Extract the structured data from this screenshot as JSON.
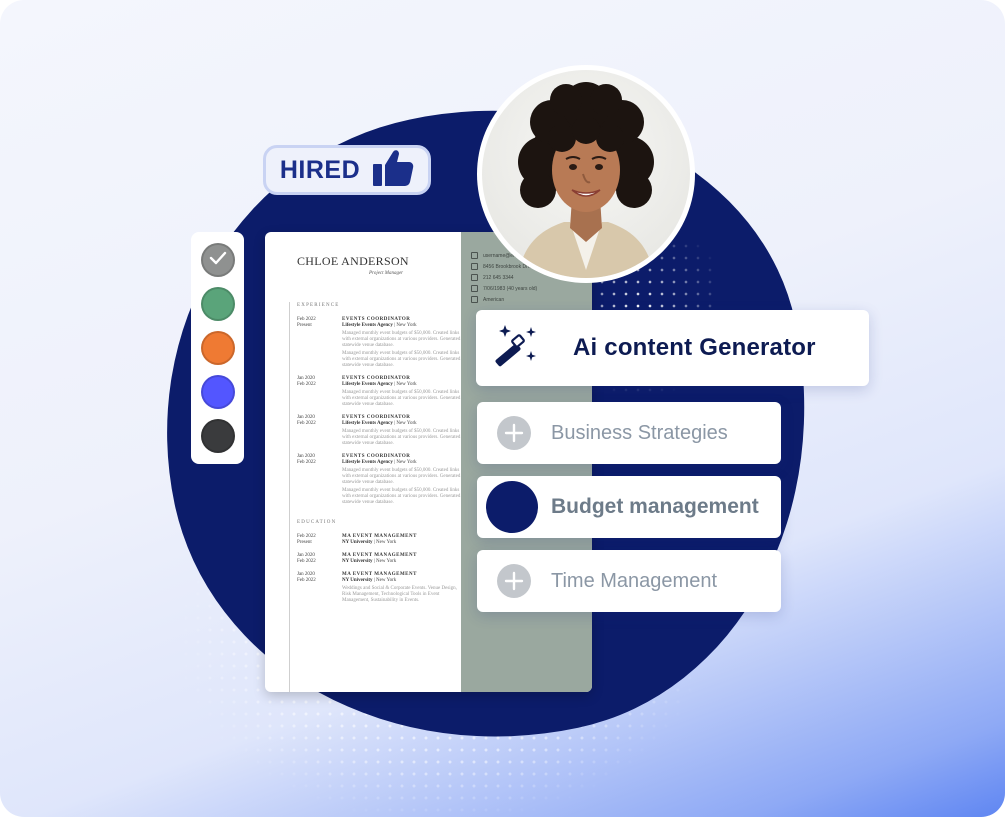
{
  "badge": {
    "label": "HIRED"
  },
  "palette": {
    "swatches": [
      {
        "name": "gray-check",
        "color": "#8f9190",
        "selected": true
      },
      {
        "name": "green",
        "color": "#5aa47a"
      },
      {
        "name": "orange",
        "color": "#ef7a33"
      },
      {
        "name": "violet",
        "color": "#5356ff"
      },
      {
        "name": "charcoal",
        "color": "#3a3b3d"
      }
    ]
  },
  "resume": {
    "name": "CHLOE ANDERSON",
    "title": "Project Manager",
    "experience_heading": "EXPERIENCE",
    "experience": [
      {
        "date_from": "Feb 2022",
        "date_to": "Present",
        "role": "EVENTS COORDINATOR",
        "company": "Lifestyle Events Agency",
        "location": "New York",
        "bullets": [
          "Managed monthly event budgets of $50,000. Created links with external organizations at various providers. Generated statewide venue database.",
          "Managed monthly event budgets of $50,000. Created links with external organizations at various providers. Generated statewide venue database."
        ]
      },
      {
        "date_from": "Jan 2020",
        "date_to": "Feb 2022",
        "role": "EVENTS COORDINATOR",
        "company": "Lifestyle Events Agency",
        "location": "New York",
        "bullets": [
          "Managed monthly event budgets of $50,000. Created links with external organizations at various providers. Generated statewide venue database."
        ]
      },
      {
        "date_from": "Jan 2020",
        "date_to": "Feb 2022",
        "role": "EVENTS COORDINATOR",
        "company": "Lifestyle Events Agency",
        "location": "New York",
        "bullets": [
          "Managed monthly event budgets of $50,000. Created links with external organizations at various providers. Generated statewide venue database."
        ]
      },
      {
        "date_from": "Jan 2020",
        "date_to": "Feb 2022",
        "role": "EVENTS COORDINATOR",
        "company": "Lifestyle Events Agency",
        "location": "New York",
        "bullets": [
          "Managed monthly event budgets of $50,000. Created links with external organizations at various providers. Generated statewide venue database.",
          "Managed monthly event budgets of $50,000. Created links with external organizations at various providers. Generated statewide venue database."
        ]
      }
    ],
    "education_heading": "EDUCATION",
    "education": [
      {
        "date_from": "Feb 2022",
        "date_to": "Present",
        "degree": "MA EVENT MANAGEMENT",
        "school": "NY University",
        "location": "New York",
        "bullets": []
      },
      {
        "date_from": "Jan 2020",
        "date_to": "Feb 2022",
        "degree": "MA EVENT MANAGEMENT",
        "school": "NY University",
        "location": "New York",
        "bullets": []
      },
      {
        "date_from": "Jan 2020",
        "date_to": "Feb 2022",
        "degree": "MA EVENT MANAGEMENT",
        "school": "NY University",
        "location": "New York",
        "bullets": [
          "Weddings and Social & Corporate Events. Venue Design, Risk Management, Technological Tools in Event Management, Sustainability in Events."
        ]
      }
    ],
    "contact": [
      {
        "icon": "mail-icon",
        "text": "username@email.com"
      },
      {
        "icon": "location-icon",
        "text": "8456 Brookbrook Drive, NY"
      },
      {
        "icon": "phone-icon",
        "text": "212 645 3344"
      },
      {
        "icon": "calendar-icon",
        "text": "7/06/1983 (40 years old)"
      },
      {
        "icon": "globe-icon",
        "text": "American"
      }
    ]
  },
  "ai_card": {
    "label": "Ai content Generator"
  },
  "skills": [
    {
      "label": "Business Strategies",
      "selected": false
    },
    {
      "label": "Budget management",
      "selected": true
    },
    {
      "label": "Time Management",
      "selected": false
    }
  ]
}
